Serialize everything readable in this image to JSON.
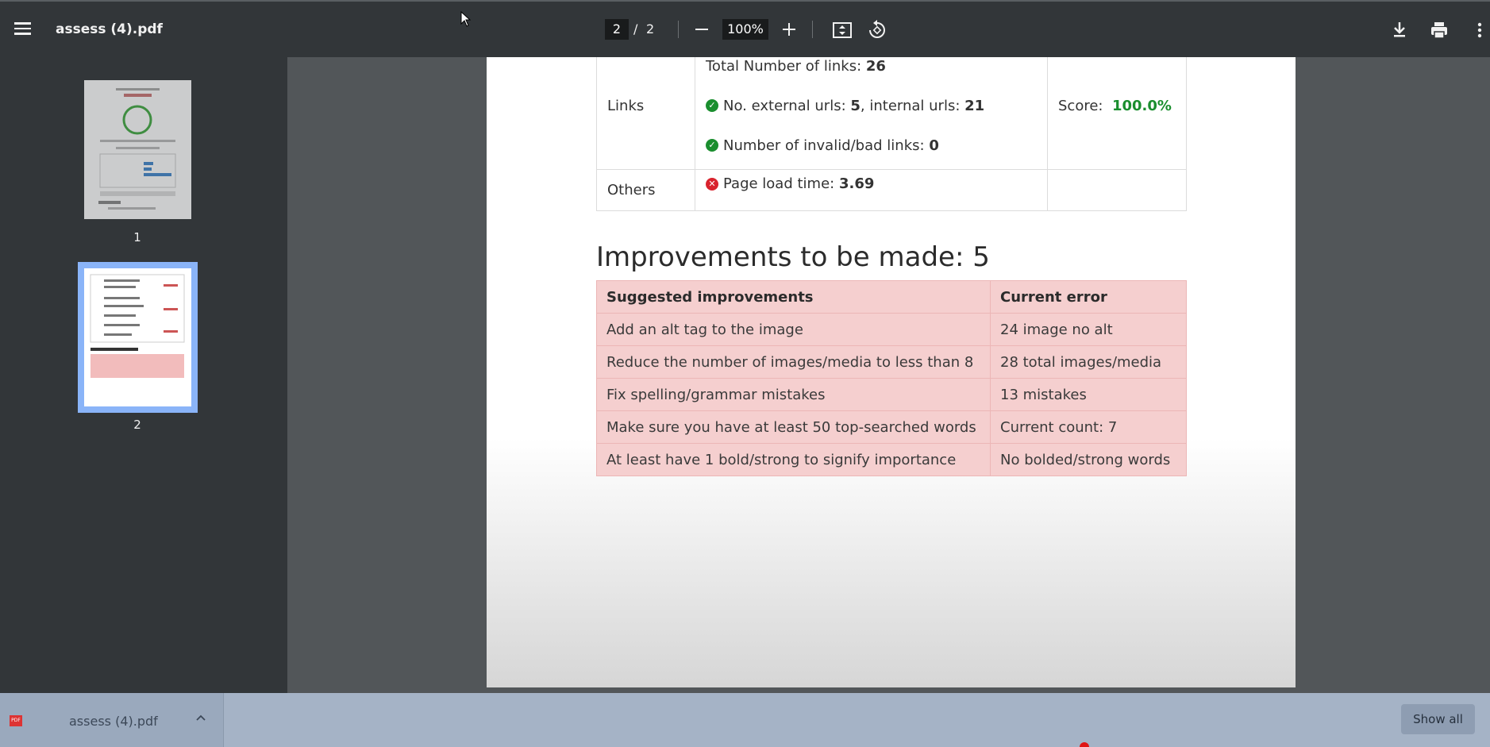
{
  "toolbar": {
    "title": "assess (4).pdf",
    "current_page": "2",
    "page_separator": "/",
    "total_pages": "2",
    "zoom": "100%"
  },
  "sidebar": {
    "thumbnails": [
      {
        "number": "1"
      },
      {
        "number": "2"
      }
    ]
  },
  "document": {
    "top_table": {
      "links": {
        "label": "Links",
        "total_label": "Total Number of links: ",
        "total_value": "26",
        "external_label": "No. external urls: ",
        "external_value": "5",
        "internal_label": ", internal urls: ",
        "internal_value": "21",
        "invalid_label": "Number of invalid/bad links: ",
        "invalid_value": "0",
        "score_label": "Score: ",
        "score_value": "100.0%"
      },
      "others": {
        "label": "Others",
        "load_label": "Page load time: ",
        "load_value": "3.69"
      }
    },
    "improvements_heading": "Improvements to be made: 5",
    "improvements_table": {
      "headers": [
        "Suggested improvements",
        "Current error"
      ],
      "rows": [
        [
          "Add an alt tag to the image",
          "24 image no alt"
        ],
        [
          "Reduce the number of images/media to less than 8",
          "28 total images/media"
        ],
        [
          "Fix spelling/grammar mistakes",
          "13 mistakes"
        ],
        [
          "Make sure you have at least 50 top-searched words",
          "Current count: 7"
        ],
        [
          "At least have 1 bold/strong to signify importance",
          "No bolded/strong words"
        ]
      ]
    }
  },
  "download_bar": {
    "file_name": "assess (4).pdf",
    "file_icon_text": "PDF",
    "show_all": "Show all"
  },
  "colors": {
    "toolbar_bg": "#323639",
    "viewer_bg": "#525659",
    "score_green": "#1a8e2e",
    "error_red": "#d9232d",
    "improvement_row_bg": "#f5cfcf",
    "selected_thumb_border": "#8ab4f8",
    "download_bar_bg": "#a5b3c6"
  },
  "icons": [
    "menu-icon",
    "zoom-out-icon",
    "zoom-in-icon",
    "fit-page-icon",
    "rotate-icon",
    "download-icon",
    "print-icon",
    "more-options-icon",
    "check-icon",
    "error-icon",
    "pdf-file-icon",
    "chevron-up-icon"
  ]
}
